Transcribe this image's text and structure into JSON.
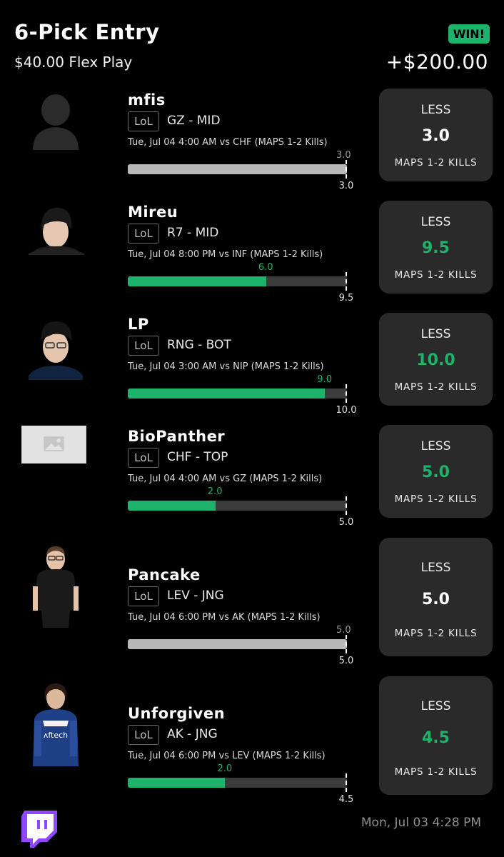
{
  "header": {
    "title": "6-Pick Entry",
    "subtitle": "$40.00 Flex Play",
    "badge": "WIN!",
    "payout": "+$200.00"
  },
  "picks": [
    {
      "name": "mfis",
      "league": "LoL",
      "team": "GZ - MID",
      "game": "Tue, Jul 04 4:00 AM  vs CHF (MAPS 1-2 Kills)",
      "actual": "3.0",
      "actual_value": 3.0,
      "line": "3.0",
      "line_value": 3.0,
      "direction": "LESS",
      "stat": "MAPS 1-2 KILLS",
      "result": "push"
    },
    {
      "name": "Mireu",
      "league": "LoL",
      "team": "R7 - MID",
      "game": "Tue, Jul 04 8:00 PM  vs INF (MAPS 1-2 Kills)",
      "actual": "6.0",
      "actual_value": 6.0,
      "line": "9.5",
      "line_value": 9.5,
      "direction": "LESS",
      "stat": "MAPS 1-2 KILLS",
      "result": "win"
    },
    {
      "name": "LP",
      "league": "LoL",
      "team": "RNG - BOT",
      "game": "Tue, Jul 04 3:00 AM  vs NIP (MAPS 1-2 Kills)",
      "actual": "9.0",
      "actual_value": 9.0,
      "line": "10.0",
      "line_value": 10.0,
      "direction": "LESS",
      "stat": "MAPS 1-2 KILLS",
      "result": "win"
    },
    {
      "name": "BioPanther",
      "league": "LoL",
      "team": "CHF - TOP",
      "game": "Tue, Jul 04 4:00 AM  vs GZ (MAPS 1-2 Kills)",
      "actual": "2.0",
      "actual_value": 2.0,
      "line": "5.0",
      "line_value": 5.0,
      "direction": "LESS",
      "stat": "MAPS 1-2 KILLS",
      "result": "win"
    },
    {
      "name": "Pancake",
      "league": "LoL",
      "team": "LEV - JNG",
      "game": "Tue, Jul 04 6:00 PM  vs AK (MAPS 1-2 Kills)",
      "actual": "5.0",
      "actual_value": 5.0,
      "line": "5.0",
      "line_value": 5.0,
      "direction": "LESS",
      "stat": "MAPS 1-2 KILLS",
      "result": "push"
    },
    {
      "name": "Unforgiven",
      "league": "LoL",
      "team": "AK - JNG",
      "game": "Tue, Jul 04 6:00 PM  vs LEV (MAPS 1-2 Kills)",
      "actual": "2.0",
      "actual_value": 2.0,
      "line": "4.5",
      "line_value": 4.5,
      "direction": "LESS",
      "stat": "MAPS 1-2 KILLS",
      "result": "win"
    }
  ],
  "footer": {
    "logo": "twitch-icon",
    "timestamp": "Mon, Jul 03 4:28 PM"
  },
  "colors": {
    "win": "#1db36b",
    "push": "#b8b8b8",
    "card": "#2a2a2a"
  }
}
